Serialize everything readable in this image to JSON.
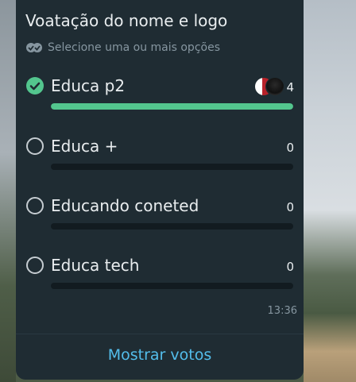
{
  "poll": {
    "title": "Voatação do nome e logo",
    "subtitle": "Selecione uma ou mais opções",
    "options": [
      {
        "label": "Educa p2",
        "count": "4",
        "checked": true,
        "fill": 1.0
      },
      {
        "label": "Educa +",
        "count": "0",
        "checked": false,
        "fill": 0
      },
      {
        "label": "Educando coneted",
        "count": "0",
        "checked": false,
        "fill": 0
      },
      {
        "label": "Educa tech",
        "count": "0",
        "checked": false,
        "fill": 0
      }
    ],
    "time": "13:36",
    "show_votes_label": "Mostrar votos"
  },
  "icons": {
    "subtitle_icon": "double-check-icon",
    "checked_radio": "check-circle-icon",
    "radio": "radio-empty-icon"
  },
  "colors": {
    "card_bg": "#1f2c33",
    "accent_green": "#53c68e",
    "link_blue": "#53bdeb",
    "text_primary": "#e9edef",
    "text_secondary": "#8696a0"
  }
}
